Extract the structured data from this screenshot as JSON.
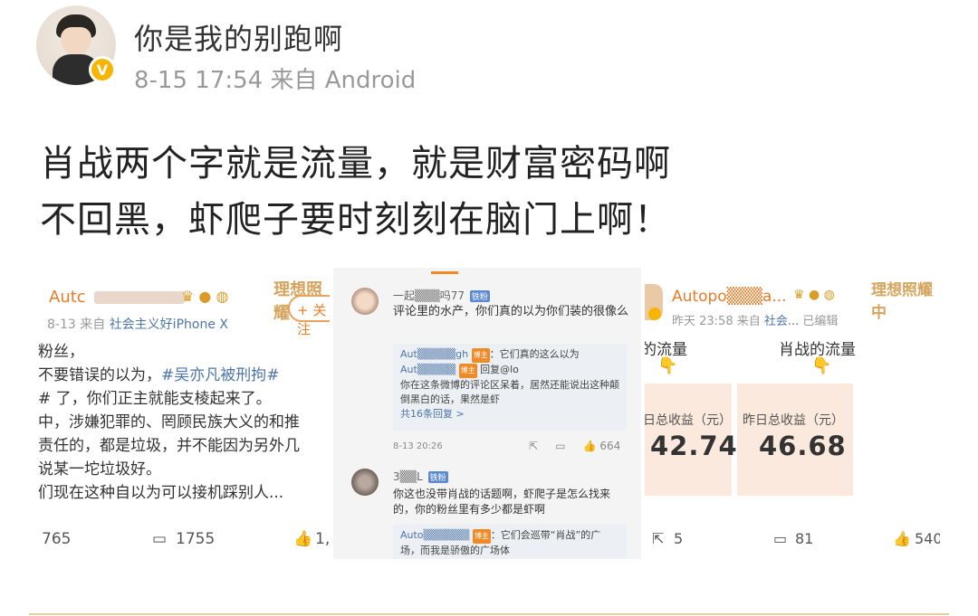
{
  "post": {
    "username": "你是我的别跑啊",
    "verified_badge": "V",
    "meta": "8-15 17:54 来自 Android",
    "text_line1": "肖战两个字就是流量，就是财富密码啊",
    "text_line2": "不回黑，虾爬子要时刻刻在脑门上啊！"
  },
  "images": {
    "img1": {
      "name": "Autc",
      "brand": "理想照耀",
      "follow": "+ 关注",
      "meta_date": "8-13  来自",
      "meta_source": "社会主义好iPhone X",
      "body": [
        "粉丝，",
        "不要错误的以为，",
        "#吴亦凡被刑拘#",
        "# 了，你们正主就能支棱起来了。",
        "中，涉嫌犯罪的、罔顾民族大义的和推",
        "责任的，都是垃圾，并不能因为另外几",
        "说某一坨垃圾好。",
        "们现在这种自以为可以接机踩别人..."
      ],
      "reposts": "765",
      "comments": "1755",
      "likes": "1,"
    },
    "img2": {
      "c1_name": "一起",
      "c1_name_suffix": "吗77",
      "c1_tag": "铁粉",
      "c1_text": "评论里的水产，你们真的以为你们装的很像么",
      "r1_name": "Aut",
      "r1_name_suffix": "gh",
      "r1_badge": "博主",
      "r1_text": "：它们真的这么以为",
      "r2_name": "Aut",
      "r2_badge": "博主",
      "r2_text": " 回复@lo",
      "r3_text": "你在这条微博的评论区呆着，居然还能说出这种颠倒黑白的话，果然是虾",
      "more": "共16条回复 >",
      "date": "8-13 20:26",
      "likes": "664",
      "c2_name": "3",
      "c2_name_suffix": "L",
      "c2_tag": "铁粉",
      "c2_text": "你这也没带肖战的话题啊，虾爬子是怎么找来的，你的粉丝里有多少都是虾啊",
      "r4_name": "Auto",
      "r4_badge": "博主",
      "r4_text": "：它们会巡带“肖战”的广场，而我是骄傲的广场体"
    },
    "img3": {
      "name": "Autopo",
      "name_suffix": "a...",
      "brand": "理想照耀中",
      "meta_date": "昨天 23:58  来自",
      "meta_source": "社会...",
      "meta_edit": " 已编辑",
      "label1": "的流量",
      "label2": "肖战的流量",
      "card1_title": "日总收益（元）",
      "card1_value": "42.74",
      "card2_title": "昨日总收益（元）",
      "card2_value": "46.68",
      "reposts": "5",
      "comments": "81",
      "likes": "540"
    }
  }
}
